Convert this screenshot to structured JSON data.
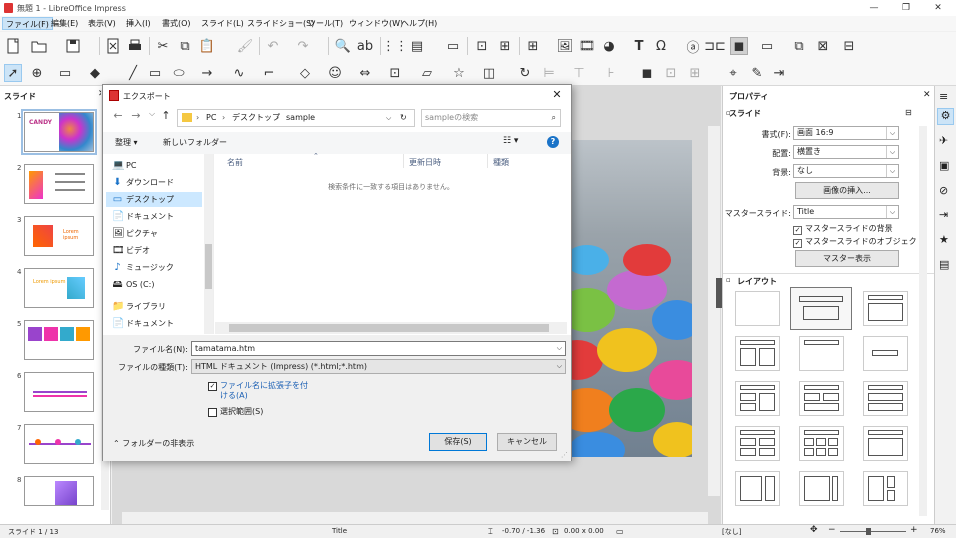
{
  "window": {
    "title": "無題 1 - LibreOffice Impress",
    "minimize": "—",
    "restore": "❐",
    "close": "✕"
  },
  "menu": [
    {
      "label": "ファイル(F)"
    },
    {
      "label": "編集(E)"
    },
    {
      "label": "表示(V)"
    },
    {
      "label": "挿入(I)"
    },
    {
      "label": "書式(O)"
    },
    {
      "label": "スライド(L)"
    },
    {
      "label": "スライドショー(S)"
    },
    {
      "label": "ツール(T)"
    },
    {
      "label": "ウィンドウ(W)"
    },
    {
      "label": "ヘルプ(H)"
    }
  ],
  "slide_panel": {
    "title": "スライド",
    "thumbnails": [
      {
        "num": "1",
        "text": "CANDY"
      },
      {
        "num": "2",
        "text": ""
      },
      {
        "num": "3",
        "text": "Lorem ipsum"
      },
      {
        "num": "4",
        "text": "Lorem ipsum"
      },
      {
        "num": "5",
        "text": ""
      },
      {
        "num": "6",
        "text": ""
      },
      {
        "num": "7",
        "text": ""
      },
      {
        "num": "8",
        "text": ""
      }
    ]
  },
  "properties": {
    "title": "プロパティ",
    "slide_section": "スライド",
    "format_label": "書式(F):",
    "format_value": "画面 16:9",
    "orientation_label": "配置:",
    "orientation_value": "横置き",
    "background_label": "背景:",
    "background_value": "なし",
    "insert_image": "画像の挿入...",
    "master_label": "マスタースライド:",
    "master_value": "Title",
    "master_bg": "マスタースライドの背景",
    "master_obj": "マスタースライドのオブジェクト",
    "master_view": "マスター表示",
    "layout_section": "レイアウト"
  },
  "dialog": {
    "title": "エクスポート",
    "close": "✕",
    "path": {
      "pc": "PC",
      "desktop": "デスクトップ",
      "folder": "sample"
    },
    "search_placeholder": "sampleの検索",
    "organize": "整理 ▾",
    "new_folder": "新しいフォルダー",
    "help": "?",
    "nav": [
      {
        "label": "PC",
        "icon": "💻"
      },
      {
        "label": "ダウンロード",
        "icon": "⬇"
      },
      {
        "label": "デスクトップ",
        "icon": "▭"
      },
      {
        "label": "ドキュメント",
        "icon": "📄"
      },
      {
        "label": "ピクチャ",
        "icon": "🖼"
      },
      {
        "label": "ビデオ",
        "icon": "🎞"
      },
      {
        "label": "ミュージック",
        "icon": "♪"
      },
      {
        "label": "OS (C:)",
        "icon": "🖴"
      },
      {
        "label": "ライブラリ",
        "icon": "📁"
      },
      {
        "label": "ドキュメント",
        "icon": "📄"
      }
    ],
    "columns": {
      "name": "名前",
      "date": "更新日時",
      "type": "種類"
    },
    "empty_message": "検索条件に一致する項目はありません。",
    "filename_label": "ファイル名(N):",
    "filename_value": "tamatama.htm",
    "filetype_label": "ファイルの種類(T):",
    "filetype_value": "HTML ドキュメント (Impress) (*.html;*.htm)",
    "auto_ext": "ファイル名に拡張子を付ける(A)",
    "selection": "選択範囲(S)",
    "hide_folders": "フォルダーの非表示",
    "save": "保存(S)",
    "cancel": "キャンセル"
  },
  "status": {
    "slide": "スライド 1 / 13",
    "layout": "Title",
    "position": "-0.70 / -1.36",
    "size": "0.00 x 0.00",
    "language": "[なし]",
    "zoom": "76%"
  }
}
